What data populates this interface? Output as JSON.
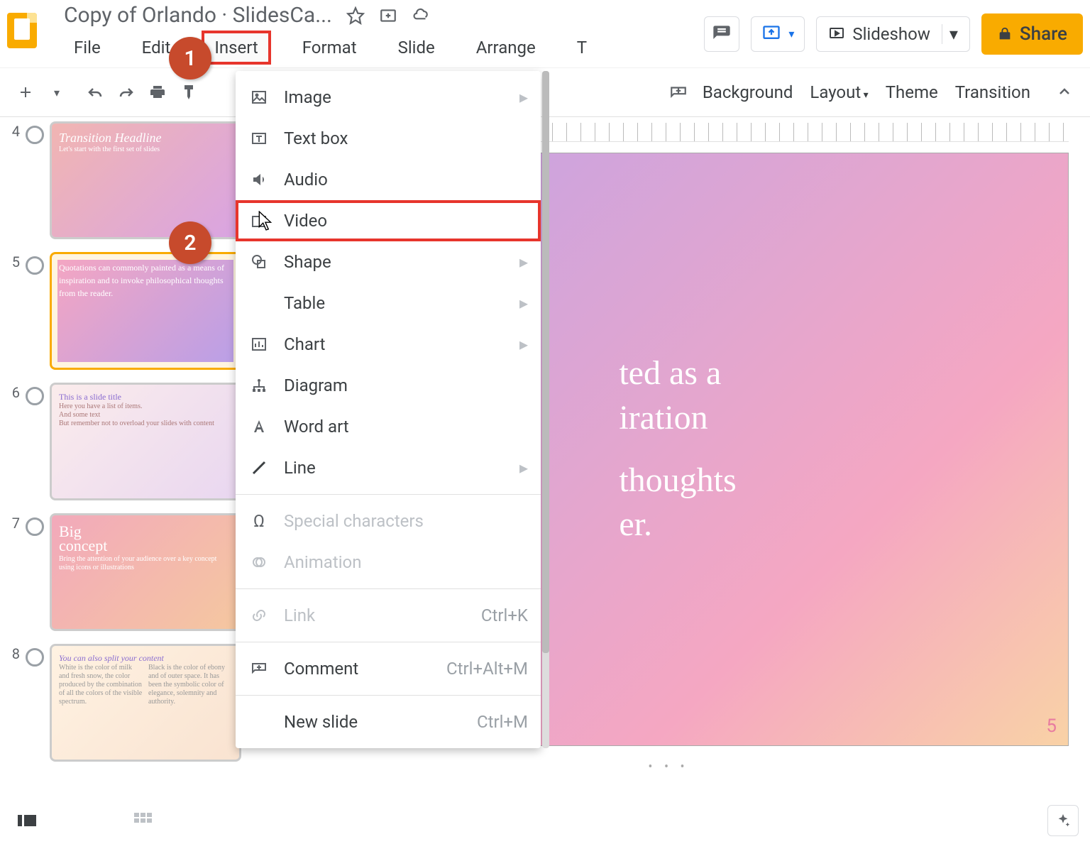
{
  "document": {
    "title": "Copy of Orlando · SlidesCa..."
  },
  "actions": {
    "slideshow": "Slideshow",
    "share": "Share"
  },
  "menubar": {
    "file": "File",
    "edit": "Edit",
    "insert": "Insert",
    "format": "Format",
    "slide": "Slide",
    "arrange": "Arrange",
    "tools_initial": "T"
  },
  "toolbar": {
    "background": "Background",
    "layout": "Layout",
    "theme": "Theme",
    "transition": "Transition"
  },
  "insert_menu": {
    "image": "Image",
    "textbox": "Text box",
    "audio": "Audio",
    "video": "Video",
    "shape": "Shape",
    "table": "Table",
    "chart": "Chart",
    "diagram": "Diagram",
    "wordart": "Word art",
    "line": "Line",
    "special": "Special characters",
    "animation": "Animation",
    "link": "Link",
    "link_shortcut": "Ctrl+K",
    "comment": "Comment",
    "comment_shortcut": "Ctrl+Alt+M",
    "newslide": "New slide",
    "newslide_shortcut": "Ctrl+M"
  },
  "thumbnails": {
    "n4": "4",
    "n5": "5",
    "n6": "6",
    "n7": "7",
    "n8": "8",
    "t4a": "Transition Headline",
    "t4b": "Let's start with the first set of slides",
    "t5": "Quotations can commonly painted as a means of inspiration and to invoke philosophical thoughts from the reader.",
    "t6a": "This is a slide title",
    "t6b": "Here you have a list of items.",
    "t6c": "And some text",
    "t6d": "But remember not to overload your slides with content",
    "t7a": "Big",
    "t7b": "concept",
    "t7c": "Bring the attention of your audience over a key concept using icons or illustrations",
    "t8a": "You can also split your content"
  },
  "slide": {
    "line1": "ted as a",
    "line2": "iration",
    "line3": "thoughts",
    "line4": "er.",
    "number": "5"
  },
  "steps": {
    "s1": "1",
    "s2": "2"
  }
}
